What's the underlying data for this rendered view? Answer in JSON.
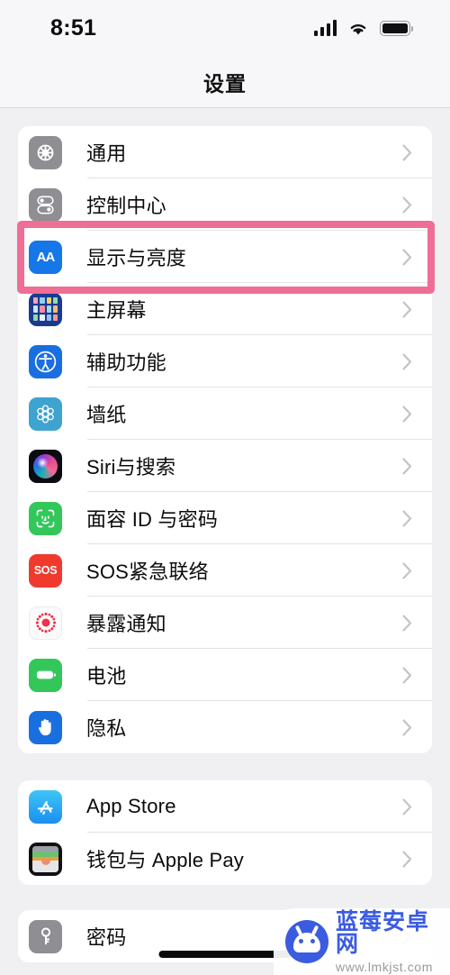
{
  "status_bar": {
    "time": "8:51",
    "signal_icon": "cellular-signal-icon",
    "wifi_icon": "wifi-icon",
    "battery_icon": "battery-full-icon"
  },
  "navbar": {
    "title": "设置"
  },
  "highlight": {
    "color": "#ee6e96",
    "target_row": "显示与亮度"
  },
  "groups": [
    {
      "name": "system-group",
      "rows": [
        {
          "label": "通用",
          "icon": "gear-icon"
        },
        {
          "label": "控制中心",
          "icon": "control-center-icon"
        },
        {
          "label": "显示与亮度",
          "icon": "display-brightness-aa-icon"
        },
        {
          "label": "主屏幕",
          "icon": "home-screen-grid-icon"
        },
        {
          "label": "辅助功能",
          "icon": "accessibility-icon"
        },
        {
          "label": "墙纸",
          "icon": "wallpaper-flower-icon"
        },
        {
          "label": "Siri与搜索",
          "icon": "siri-icon"
        },
        {
          "label": "面容 ID 与密码",
          "icon": "face-id-icon"
        },
        {
          "label": "SOS紧急联络",
          "icon": "emergency-sos-icon"
        },
        {
          "label": "暴露通知",
          "icon": "exposure-notification-icon"
        },
        {
          "label": "电池",
          "icon": "battery-icon"
        },
        {
          "label": "隐私",
          "icon": "privacy-hand-icon"
        }
      ]
    },
    {
      "name": "store-group",
      "rows": [
        {
          "label": "App Store",
          "icon": "app-store-icon"
        },
        {
          "label": "钱包与 Apple Pay",
          "icon": "wallet-icon"
        }
      ]
    },
    {
      "name": "passwords-group",
      "rows": [
        {
          "label": "密码",
          "icon": "passwords-key-icon"
        }
      ]
    }
  ],
  "watermark": {
    "site_name": "蓝莓安卓网",
    "url": "www.lmkjst.com",
    "logo_icon": "android-robot-logo-icon"
  }
}
